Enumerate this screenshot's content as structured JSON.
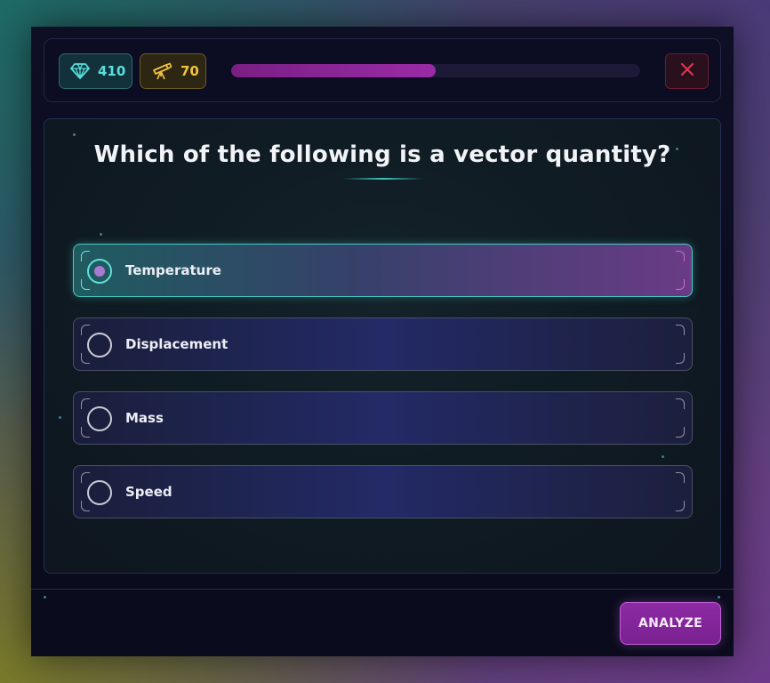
{
  "stats": {
    "gems": {
      "value": "410",
      "icon": "diamond-icon",
      "color": "#57e0dc"
    },
    "telescopes": {
      "value": "70",
      "icon": "telescope-icon",
      "color": "#f2c23f"
    }
  },
  "progress": {
    "fraction": 0.5,
    "color": "#9a2ba6"
  },
  "close": {
    "icon": "close-icon",
    "color": "#e0354f"
  },
  "question": {
    "text": "Which of the following is a vector quantity?"
  },
  "options": [
    {
      "label": "Temperature",
      "selected": true
    },
    {
      "label": "Displacement",
      "selected": false
    },
    {
      "label": "Mass",
      "selected": false
    },
    {
      "label": "Speed",
      "selected": false
    }
  ],
  "footer": {
    "analyze_label": "ANALYZE"
  },
  "colors": {
    "accent_teal": "#48c9c2",
    "accent_purple": "#8c2aa2"
  }
}
